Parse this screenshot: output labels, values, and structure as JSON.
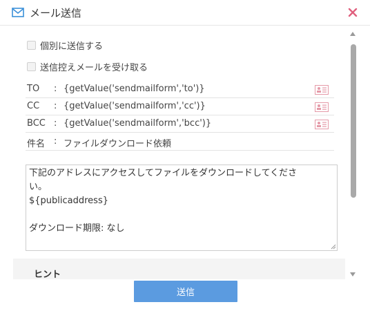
{
  "dialog": {
    "title": "メール送信"
  },
  "options": [
    {
      "label": "個別に送信する",
      "checked": false
    },
    {
      "label": "送信控えメールを受け取る",
      "checked": false
    }
  ],
  "fields": [
    {
      "label": "TO",
      "colon": ":",
      "value": "{getValue('sendmailform','to')}",
      "has_address_book": true
    },
    {
      "label": "CC",
      "colon": ":",
      "value": "{getValue('sendmailform','cc')}",
      "has_address_book": true
    },
    {
      "label": "BCC",
      "colon": ":",
      "value": "{getValue('sendmailform','bcc')}",
      "has_address_book": true
    },
    {
      "label": "件名",
      "colon": ":",
      "value": "ファイルダウンロード依頼",
      "has_address_book": false
    }
  ],
  "body": {
    "lines": [
      "下記のアドレスにアクセスしてファイルをダウンロードしてくださ",
      "い。",
      "${publicaddress}",
      "",
      "ダウンロード期限: なし"
    ]
  },
  "hint": {
    "title": "ヒント"
  },
  "footer": {
    "send_label": "送信"
  },
  "colors": {
    "accent": "#5b9be0",
    "close": "#e0607e",
    "address_icon": "#e59aa8"
  },
  "icons": {
    "title": "mail-icon",
    "close": "close-icon",
    "address_book": "address-book-icon"
  }
}
